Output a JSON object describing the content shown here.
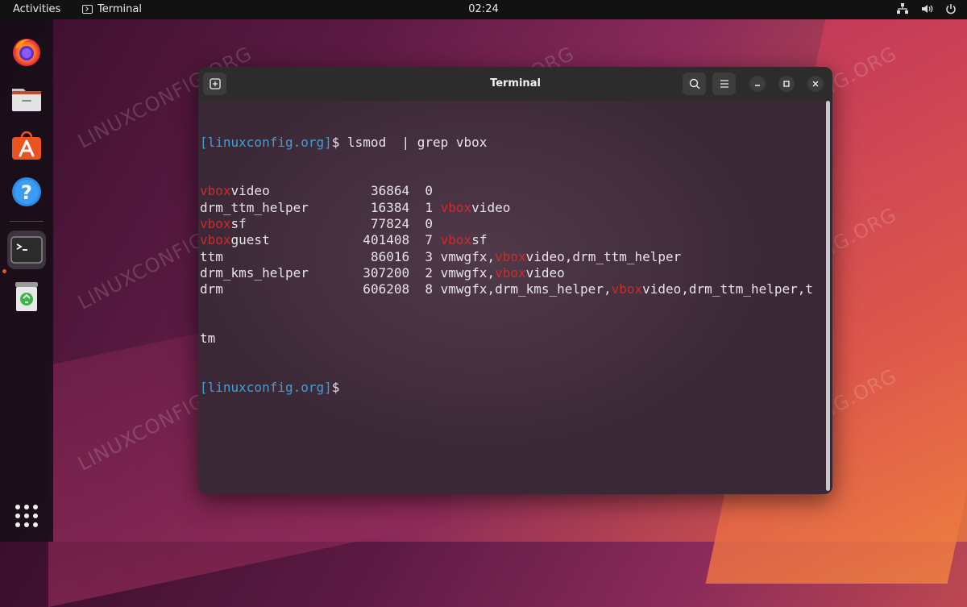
{
  "topbar": {
    "activities": "Activities",
    "app_name": "Terminal",
    "clock": "02:24",
    "icons": [
      "network-icon",
      "volume-icon",
      "power-icon"
    ]
  },
  "dock": {
    "items": [
      "firefox-icon",
      "files-icon",
      "app-center-icon",
      "help-icon",
      "terminal-icon",
      "trash-icon"
    ],
    "active": "terminal-icon",
    "grid": "show-apps-icon"
  },
  "watermark": "LINUXCONFIG.ORG",
  "window": {
    "title": "Terminal",
    "buttons": [
      "new-tab-icon",
      "search-icon",
      "menu-icon",
      "minimize-icon",
      "maximize-icon",
      "close-icon"
    ]
  },
  "terminal": {
    "prompt": "[linuxconfig.org]",
    "command": "$ lsmod  | grep vbox",
    "final_prompt": "[linuxconfig.org]",
    "final_suffix": "$",
    "rows": [
      {
        "module": "vboxvideo",
        "size": "36864",
        "used": "0",
        "by": ""
      },
      {
        "module": "drm_ttm_helper",
        "size": "16384",
        "used": "1",
        "by": "vboxvideo"
      },
      {
        "module": "vboxsf",
        "size": "77824",
        "used": "0",
        "by": ""
      },
      {
        "module": "vboxguest",
        "size": "401408",
        "used": "7",
        "by": "vboxsf"
      },
      {
        "module": "ttm",
        "size": "86016",
        "used": "3",
        "by": "vmwgfx,vboxvideo,drm_ttm_helper"
      },
      {
        "module": "drm_kms_helper",
        "size": "307200",
        "used": "2",
        "by": "vmwgfx,vboxvideo"
      },
      {
        "module": "drm",
        "size": "606208",
        "used": "8",
        "by": "vmwgfx,drm_kms_helper,vboxvideo,drm_ttm_helper,t"
      }
    ],
    "wrap_line": "tm",
    "highlight": "vbox",
    "colors": {
      "prompt": "#3e9fd6",
      "highlight": "#d02a2a",
      "text": "#e8e4e6"
    }
  }
}
